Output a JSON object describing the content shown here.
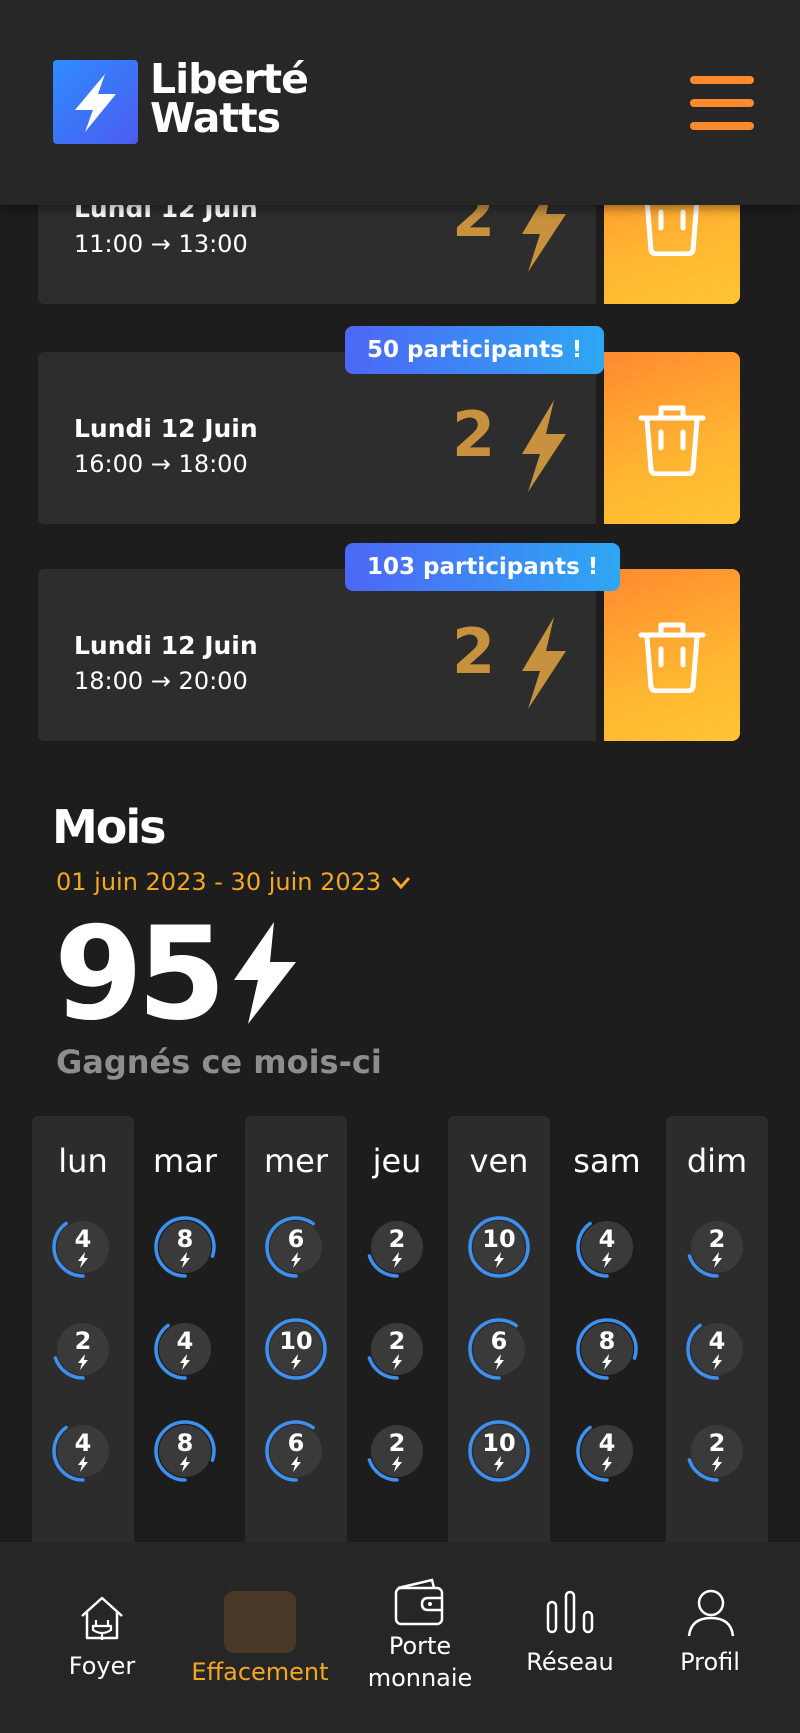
{
  "app": {
    "logo_line1": "Liberté",
    "logo_line2": "Watts",
    "colors": {
      "accent": "#f5a623",
      "brand_blue": "#3d7bf7",
      "ring": "#3d8ff0"
    }
  },
  "bookings": [
    {
      "date": "Lundi 12 Juin",
      "start": "11:00",
      "end": "13:00",
      "points": "2",
      "badge": ""
    },
    {
      "date": "Lundi 12 Juin",
      "start": "16:00",
      "end": "18:00",
      "points": "2",
      "badge": "50 participants !"
    },
    {
      "date": "Lundi 12 Juin",
      "start": "18:00",
      "end": "20:00",
      "points": "2",
      "badge": "103 participants !"
    }
  ],
  "month": {
    "title": "Mois",
    "range": "01 juin 2023 - 30 juin 2023",
    "total": "95",
    "subtitle": "Gagnés ce mois-ci"
  },
  "calendar": {
    "days": [
      "lun",
      "mar",
      "mer",
      "jeu",
      "ven",
      "sam",
      "dim"
    ],
    "rows": [
      [
        "4",
        "8",
        "6",
        "2",
        "10",
        "4",
        "2"
      ],
      [
        "2",
        "4",
        "10",
        "2",
        "6",
        "8",
        "4"
      ],
      [
        "4",
        "8",
        "6",
        "2",
        "10",
        "4",
        "2"
      ]
    ],
    "max": 10
  },
  "nav": {
    "items": [
      {
        "label": "Foyer",
        "icon": "home-plug-icon"
      },
      {
        "label": "Effacement",
        "icon": "bolt-icon"
      },
      {
        "label": "Porte monnaie",
        "icon": "wallet-icon"
      },
      {
        "label": "Réseau",
        "icon": "bars-icon"
      },
      {
        "label": "Profil",
        "icon": "user-icon"
      }
    ],
    "active": "Effacement"
  }
}
